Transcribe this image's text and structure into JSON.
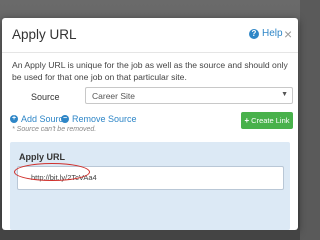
{
  "modal": {
    "title": "Apply URL",
    "help_label": "Help",
    "close_glyph": "×",
    "description": "An Apply URL is unique for the job as well as the source and should only be used for that one job on that particular site."
  },
  "source": {
    "label": "Source",
    "selected": "Career Site",
    "caret_glyph": "▼"
  },
  "actions": {
    "add_source": "Add Source",
    "remove_source": "Remove Source",
    "note": "* Source can't be removed.",
    "create_link": "Create Link"
  },
  "apply_url": {
    "label": "Apply URL",
    "value": "http://bit.ly/2TcVAa4"
  },
  "icons": {
    "help": "question-circle-icon",
    "add": "plus-circle-icon",
    "remove": "minus-circle-icon",
    "create": "plus-icon"
  },
  "colors": {
    "link": "#2e86c7",
    "create_button": "#48b14b",
    "panel_bg": "#dce9f5",
    "annotation": "#d0312d"
  }
}
